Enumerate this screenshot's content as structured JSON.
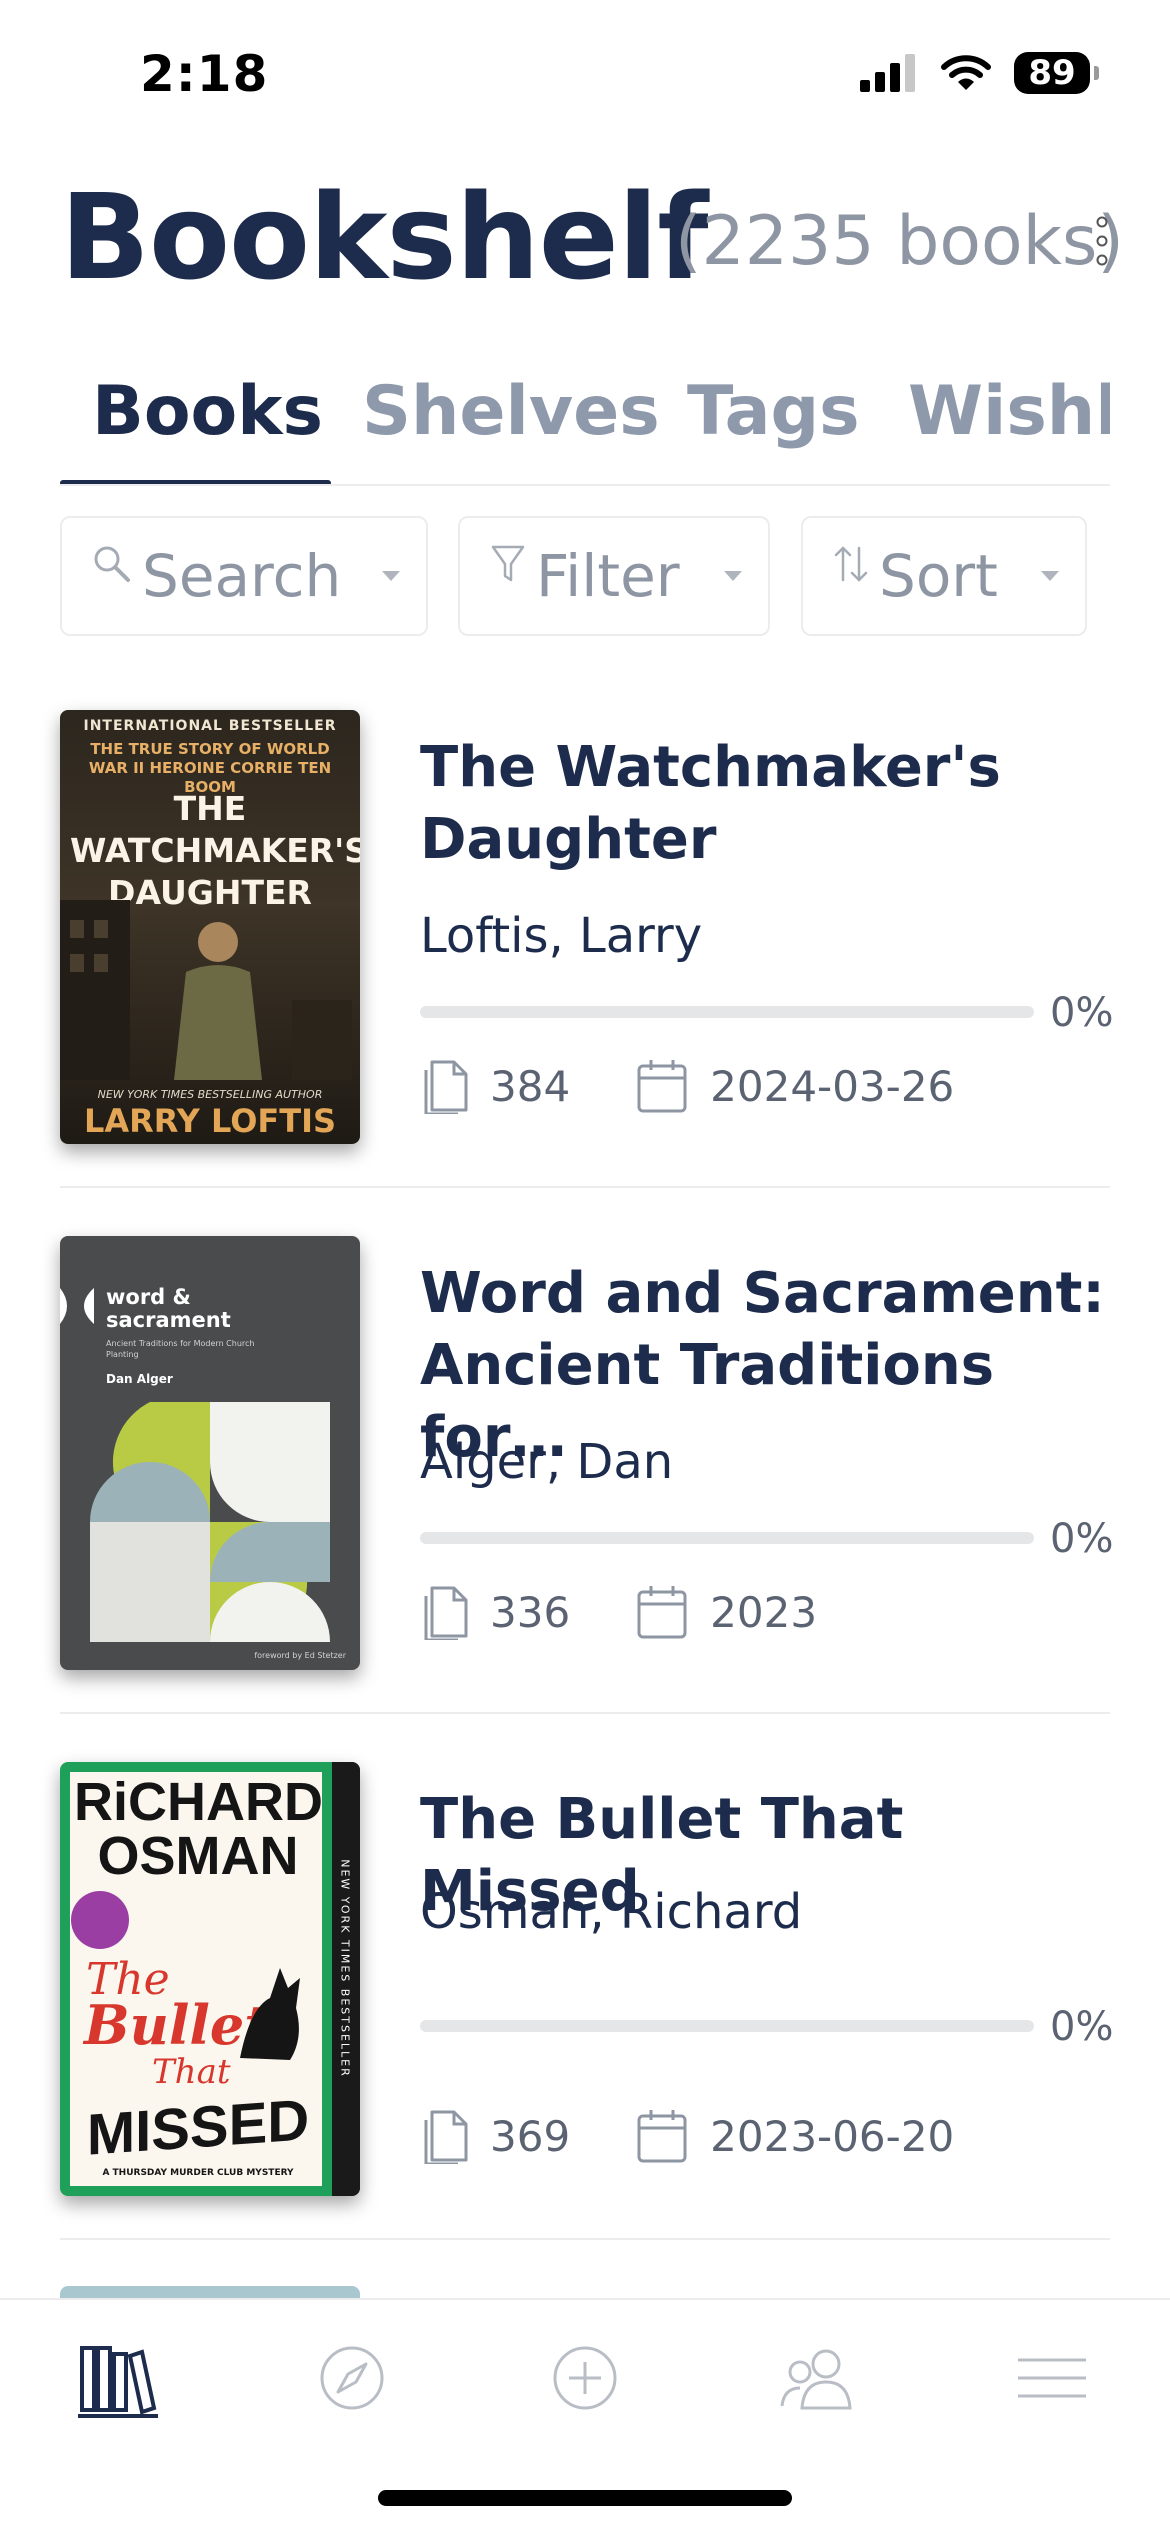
{
  "status_bar": {
    "time": "2:18",
    "battery": "89"
  },
  "header": {
    "title": "Bookshelf",
    "count": "(2235 books)"
  },
  "tabs": [
    {
      "label": "Books",
      "active": true
    },
    {
      "label": "Shelves",
      "active": false
    },
    {
      "label": "Tags",
      "active": false
    },
    {
      "label": "Wishli",
      "active": false
    }
  ],
  "controls": {
    "search_label": "Search",
    "filter_label": "Filter",
    "sort_label": "Sort"
  },
  "books": [
    {
      "title": "The Watchmaker's Daughter",
      "author": "Loftis, Larry",
      "progress_percent": 0,
      "progress_label": "0%",
      "pages": "384",
      "date": "2024-03-26",
      "cover": {
        "top_line": "INTERNATIONAL BESTSELLER",
        "subtitle": "THE TRUE STORY OF WORLD WAR II HEROINE CORRIE TEN BOOM",
        "title": "THE WATCHMAKER'S DAUGHTER",
        "tagline": "NEW YORK TIMES BESTSELLING AUTHOR",
        "author": "LARRY LOFTIS"
      }
    },
    {
      "title": "Word and Sacrament: Ancient Traditions for…",
      "author": "Alger, Dan",
      "progress_percent": 0,
      "progress_label": "0%",
      "pages": "336",
      "date": "2023",
      "cover": {
        "title": "word & sacrament",
        "subtitle": "Ancient Traditions for Modern Church Planting",
        "author": "Dan Alger",
        "foreword": "foreword by Ed Stetzer"
      }
    },
    {
      "title": "The Bullet That Missed",
      "author": "Osman, Richard",
      "progress_percent": 0,
      "progress_label": "0%",
      "pages": "369",
      "date": "2023-06-20",
      "cover": {
        "author_line1": "RiCHARD",
        "author_line2": "OSMAN",
        "title_line1": "The",
        "title_line2": "Bullet",
        "title_line3": "That",
        "title_line4": "MISSED",
        "series": "A THURSDAY MURDER CLUB MYSTERY",
        "spine": "NEW YORK TIMES BESTSELLER"
      }
    }
  ],
  "tab_bar": [
    {
      "icon": "library-icon",
      "active": true
    },
    {
      "icon": "compass-icon",
      "active": false
    },
    {
      "icon": "add-circle-icon",
      "active": false
    },
    {
      "icon": "friends-icon",
      "active": false
    },
    {
      "icon": "menu-icon",
      "active": false
    }
  ],
  "colors": {
    "primary": "#1d2c4c",
    "muted": "#8e99ab",
    "divider": "#ececef",
    "progress_track": "#e5e6e8"
  }
}
